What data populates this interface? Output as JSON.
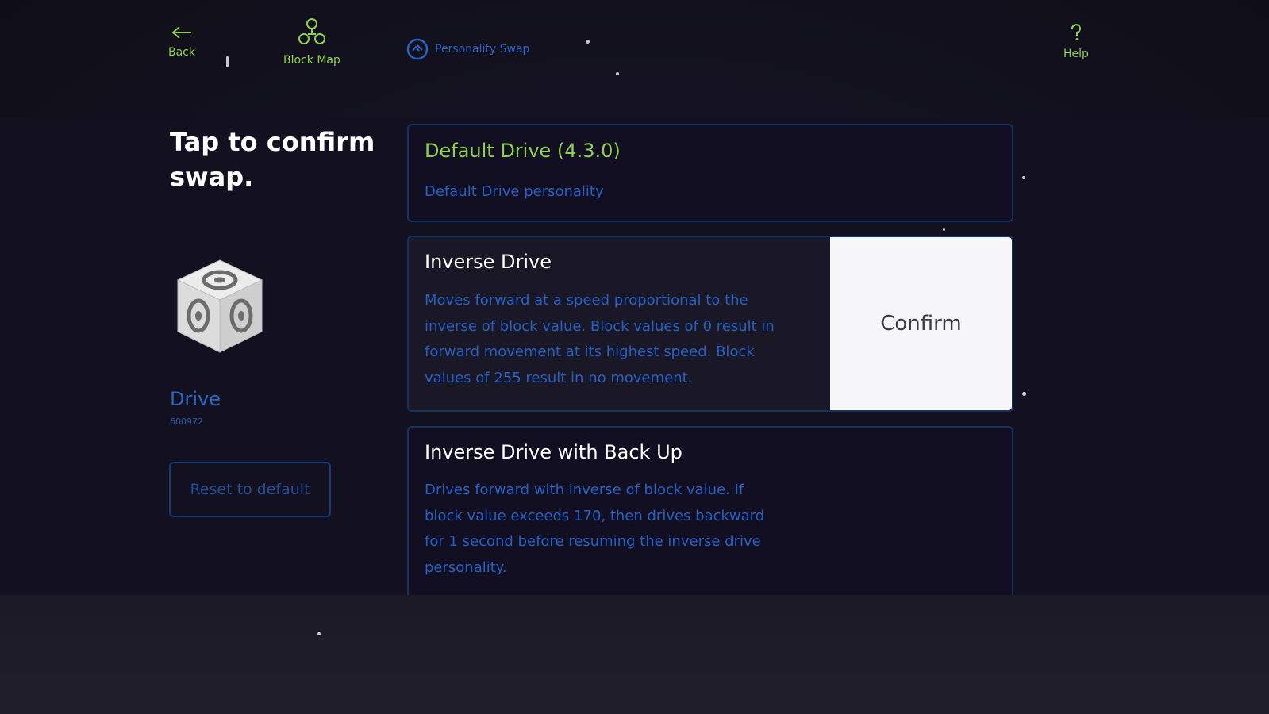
{
  "nav": {
    "back_label": "Back",
    "block_map_label": "Block Map",
    "personality_swap_label": "Personality Swap",
    "help_label": "Help"
  },
  "left": {
    "title": "Tap to confirm swap.",
    "block_name": "Drive",
    "block_id": "600972",
    "reset_label": "Reset to default"
  },
  "personalities": [
    {
      "title": "Default Drive (4.3.0)",
      "description": "Default Drive personality",
      "state": "current"
    },
    {
      "title": "Inverse Drive",
      "description": "Moves forward at a speed proportional to the inverse of block value. Block values of 0 result in forward movement at its highest speed. Block values of 255 result in no movement.",
      "state": "selected",
      "confirm_label": "Confirm"
    },
    {
      "title": "Inverse Drive with Back Up",
      "description": "Drives forward with inverse of block value. If block value exceeds 170, then drives backward for 1 second before resuming the inverse drive personality.",
      "state": "available"
    }
  ],
  "colors": {
    "accent_green": "#8fd14f",
    "link_blue": "#2660c3",
    "background": "#131120",
    "confirm_bg": "#f6f6f8"
  },
  "icons": {
    "back": "arrow-left-icon",
    "block_map": "block-map-icon",
    "personality_swap": "personality-swap-icon",
    "help": "help-icon",
    "cube": "drive-cube-icon"
  }
}
